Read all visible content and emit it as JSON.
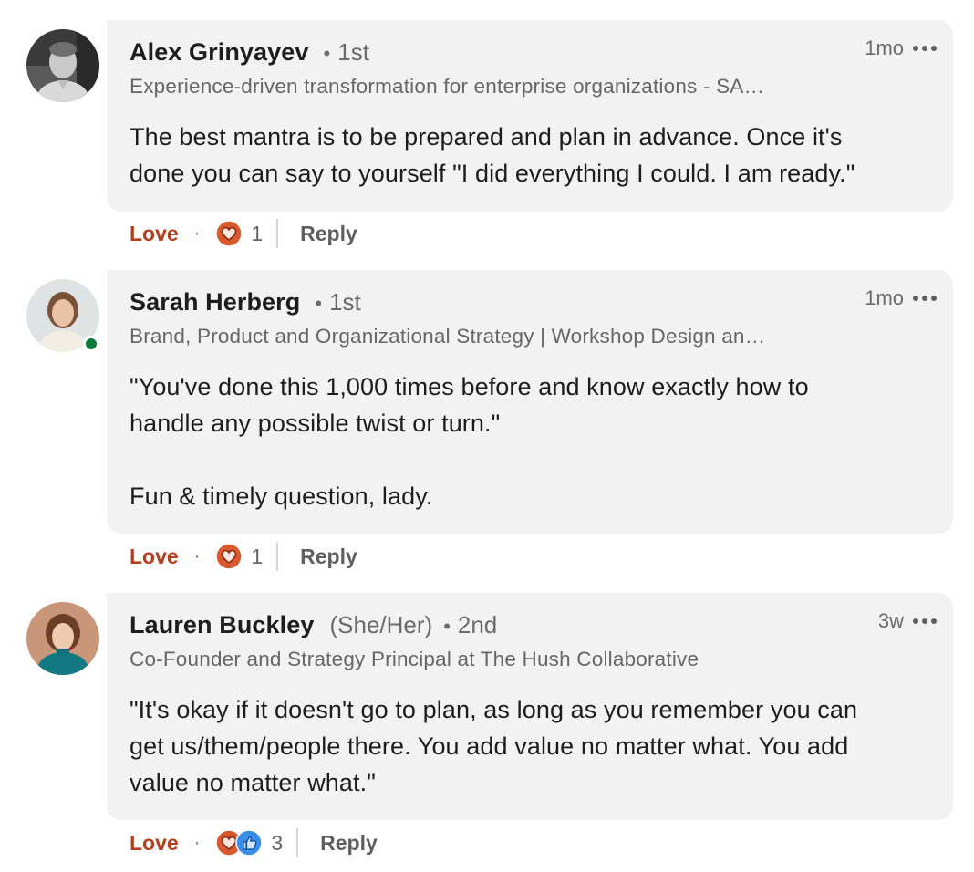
{
  "comments": [
    {
      "author": "Alex Grinyayev",
      "pronouns": "",
      "degree": "1st",
      "headline": "Experience-driven transformation for enterprise organizations - SA…",
      "timestamp": "1mo",
      "body": [
        "The best mantra is to be prepared and plan in advance. Once it's",
        "done you can say to yourself \"I did everything I could. I am ready.\""
      ],
      "action_label": "Love",
      "reaction_count": "1",
      "reactions": [
        "love-reaction-icon"
      ],
      "reply_label": "Reply",
      "online": false
    },
    {
      "author": "Sarah Herberg",
      "pronouns": "",
      "degree": "1st",
      "headline": "Brand, Product and Organizational Strategy | Workshop Design an…",
      "timestamp": "1mo",
      "body": [
        "\"You've done this 1,000 times before and know exactly how to",
        "handle any possible twist or turn.\"",
        "",
        "Fun & timely question, lady."
      ],
      "action_label": "Love",
      "reaction_count": "1",
      "reactions": [
        "love-reaction-icon"
      ],
      "reply_label": "Reply",
      "online": true
    },
    {
      "author": "Lauren Buckley",
      "pronouns": "(She/Her)",
      "degree": "2nd",
      "headline": "Co-Founder and Strategy Principal at The Hush Collaborative",
      "timestamp": "3w",
      "body": [
        "\"It's okay if it doesn't go to plan, as long as you remember you can",
        "get us/them/people there. You add value no matter what. You add",
        "value no matter what.\""
      ],
      "action_label": "Love",
      "reaction_count": "3",
      "reactions": [
        "love-reaction-icon",
        "like-reaction-icon"
      ],
      "reply_label": "Reply",
      "online": false
    }
  ],
  "separator": "·",
  "degree_separator": "•",
  "colors": {
    "bubble": "#f2f2f2",
    "love_active": "#b24020",
    "secondary_text": "#666666",
    "online_dot": "#0a7a3b",
    "love_reaction": "#d9592f",
    "like_reaction": "#378fe9"
  }
}
